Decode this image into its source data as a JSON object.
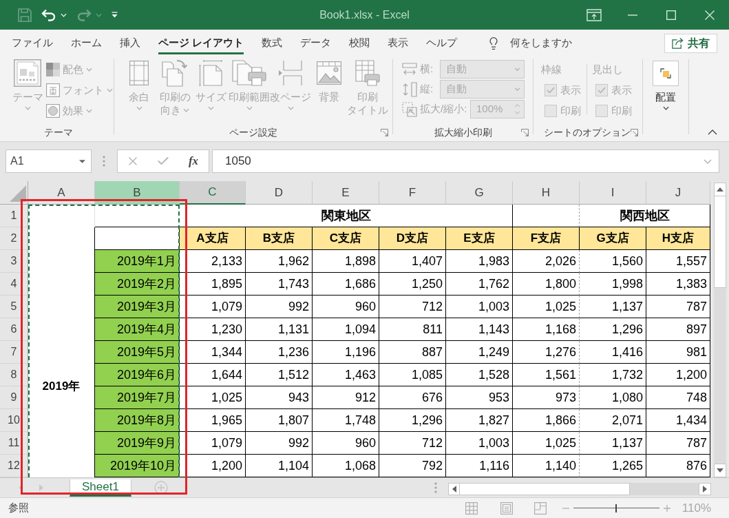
{
  "window": {
    "title": "Book1.xlsx - Excel"
  },
  "quick_access": [
    {
      "kind": "save",
      "disabled": true
    },
    {
      "kind": "undo",
      "disabled": false,
      "dropdown": true
    },
    {
      "kind": "redo",
      "disabled": true,
      "dropdown": true
    },
    {
      "kind": "customize",
      "disabled": false
    }
  ],
  "tabs": [
    {
      "label": "ファイル",
      "selected": false
    },
    {
      "label": "ホーム",
      "selected": false
    },
    {
      "label": "挿入",
      "selected": false
    },
    {
      "label": "ページ レイアウト",
      "selected": true
    },
    {
      "label": "数式",
      "selected": false
    },
    {
      "label": "データ",
      "selected": false
    },
    {
      "label": "校閲",
      "selected": false
    },
    {
      "label": "表示",
      "selected": false
    },
    {
      "label": "ヘルプ",
      "selected": false
    }
  ],
  "tell_me": {
    "placeholder": "何をしますか"
  },
  "share": {
    "label": "共有"
  },
  "ribbon": {
    "groups": [
      {
        "label": "テーマ",
        "items": [
          {
            "kind": "large",
            "lines": [
              "テーマ"
            ],
            "dropdown": true,
            "disabled": true
          },
          {
            "kind": "column",
            "items": [
              {
                "kind": "small",
                "label": "配色",
                "dropdown": true,
                "disabled": true
              },
              {
                "kind": "small",
                "label": "フォント",
                "dropdown": true,
                "disabled": true
              },
              {
                "kind": "small",
                "label": "効果",
                "dropdown": true,
                "disabled": true
              }
            ]
          }
        ]
      },
      {
        "label": "ページ設定",
        "launcher": true,
        "items": [
          {
            "kind": "large",
            "lines": [
              "余白"
            ],
            "dropdown": true,
            "disabled": true
          },
          {
            "kind": "large",
            "lines": [
              "印刷の",
              "向き"
            ],
            "dropdown": true,
            "disabled": true
          },
          {
            "kind": "large",
            "lines": [
              "サイズ"
            ],
            "dropdown": true,
            "disabled": true
          },
          {
            "kind": "large",
            "lines": [
              "印刷範囲"
            ],
            "dropdown": true,
            "disabled": true
          },
          {
            "kind": "large",
            "lines": [
              "改ページ"
            ],
            "dropdown": true,
            "disabled": true
          },
          {
            "kind": "large",
            "lines": [
              "背景"
            ],
            "disabled": true
          },
          {
            "kind": "large",
            "lines": [
              "印刷",
              "タイトル"
            ],
            "disabled": true
          }
        ]
      },
      {
        "label": "拡大縮小印刷",
        "launcher": true,
        "items": [
          {
            "kind": "column",
            "items": [
              {
                "kind": "dropdown",
                "label": "横:",
                "value": "自動",
                "disabled": true
              },
              {
                "kind": "dropdown",
                "label": "縦:",
                "value": "自動",
                "disabled": true
              },
              {
                "kind": "spinner",
                "label": "拡大/縮小:",
                "value": "100%",
                "disabled": true
              }
            ]
          }
        ]
      },
      {
        "label": "シートのオプション",
        "launcher": true,
        "items": [
          {
            "kind": "column",
            "items": [
              {
                "kind": "heading",
                "label": "枠線",
                "disabled": true
              },
              {
                "kind": "checkbox",
                "label": "表示",
                "checked": true,
                "disabled": true
              },
              {
                "kind": "checkbox",
                "label": "印刷",
                "checked": false,
                "disabled": true
              }
            ]
          },
          {
            "kind": "column",
            "items": [
              {
                "kind": "heading",
                "label": "見出し",
                "disabled": true
              },
              {
                "kind": "checkbox",
                "label": "表示",
                "checked": true,
                "disabled": true
              },
              {
                "kind": "checkbox",
                "label": "印刷",
                "checked": false,
                "disabled": true
              }
            ]
          }
        ]
      },
      {
        "items": [
          {
            "kind": "large",
            "lines": [
              "配置"
            ],
            "dropdown": true,
            "disabled": false
          }
        ]
      }
    ]
  },
  "formula_bar": {
    "name_box": "A1",
    "function_label": "fx",
    "value": "1050"
  },
  "sheet": {
    "columns": [
      {
        "label": "A",
        "selected": false,
        "active": false
      },
      {
        "label": "B",
        "selected": true,
        "active": false
      },
      {
        "label": "C",
        "selected": false,
        "active": true
      },
      {
        "label": "D",
        "selected": false,
        "active": false
      },
      {
        "label": "E",
        "selected": false,
        "active": false
      },
      {
        "label": "F",
        "selected": false,
        "active": false
      },
      {
        "label": "G",
        "selected": false,
        "active": false
      },
      {
        "label": "H",
        "selected": false,
        "active": false
      },
      {
        "label": "I",
        "selected": false,
        "active": false
      },
      {
        "label": "J",
        "selected": false,
        "active": false
      }
    ],
    "row_headers": [
      "1",
      "2",
      "3",
      "4",
      "5",
      "6",
      "7",
      "8",
      "9",
      "10",
      "11",
      "12"
    ],
    "region_headers": [
      "関東地区",
      "関西地区"
    ],
    "branch_headers": [
      "A支店",
      "B支店",
      "C支店",
      "D支店",
      "E支店",
      "F支店",
      "G支店",
      "H支店"
    ],
    "year_label": "2019年",
    "months": [
      {
        "label": "2019年1月",
        "values": [
          "2,133",
          "1,962",
          "1,898",
          "1,407",
          "1,983",
          "2,026",
          "1,560",
          "1,557"
        ]
      },
      {
        "label": "2019年2月",
        "values": [
          "1,895",
          "1,743",
          "1,686",
          "1,250",
          "1,762",
          "1,800",
          "1,998",
          "1,383"
        ]
      },
      {
        "label": "2019年3月",
        "values": [
          "1,079",
          "992",
          "960",
          "712",
          "1,003",
          "1,025",
          "1,137",
          "787"
        ]
      },
      {
        "label": "2019年4月",
        "values": [
          "1,230",
          "1,131",
          "1,094",
          "811",
          "1,143",
          "1,168",
          "1,296",
          "897"
        ]
      },
      {
        "label": "2019年5月",
        "values": [
          "1,344",
          "1,236",
          "1,196",
          "887",
          "1,249",
          "1,276",
          "1,416",
          "981"
        ]
      },
      {
        "label": "2019年6月",
        "values": [
          "1,644",
          "1,512",
          "1,463",
          "1,085",
          "1,528",
          "1,561",
          "1,732",
          "1,200"
        ]
      },
      {
        "label": "2019年7月",
        "values": [
          "1,025",
          "943",
          "912",
          "676",
          "953",
          "973",
          "1,080",
          "748"
        ]
      },
      {
        "label": "2019年8月",
        "values": [
          "1,965",
          "1,807",
          "1,748",
          "1,296",
          "1,827",
          "1,866",
          "2,071",
          "1,434"
        ]
      },
      {
        "label": "2019年9月",
        "values": [
          "1,079",
          "992",
          "960",
          "712",
          "1,003",
          "1,025",
          "1,137",
          "787"
        ]
      },
      {
        "label": "2019年10月",
        "values": [
          "1,200",
          "1,104",
          "1,068",
          "792",
          "1,116",
          "1,140",
          "1,265",
          "876"
        ]
      }
    ]
  },
  "sheet_tabs": [
    {
      "label": "Sheet1",
      "selected": true
    }
  ],
  "status_bar": {
    "mode": "参照",
    "zoom_slider": {
      "level": 0.5
    },
    "zoom_label": "110%"
  }
}
